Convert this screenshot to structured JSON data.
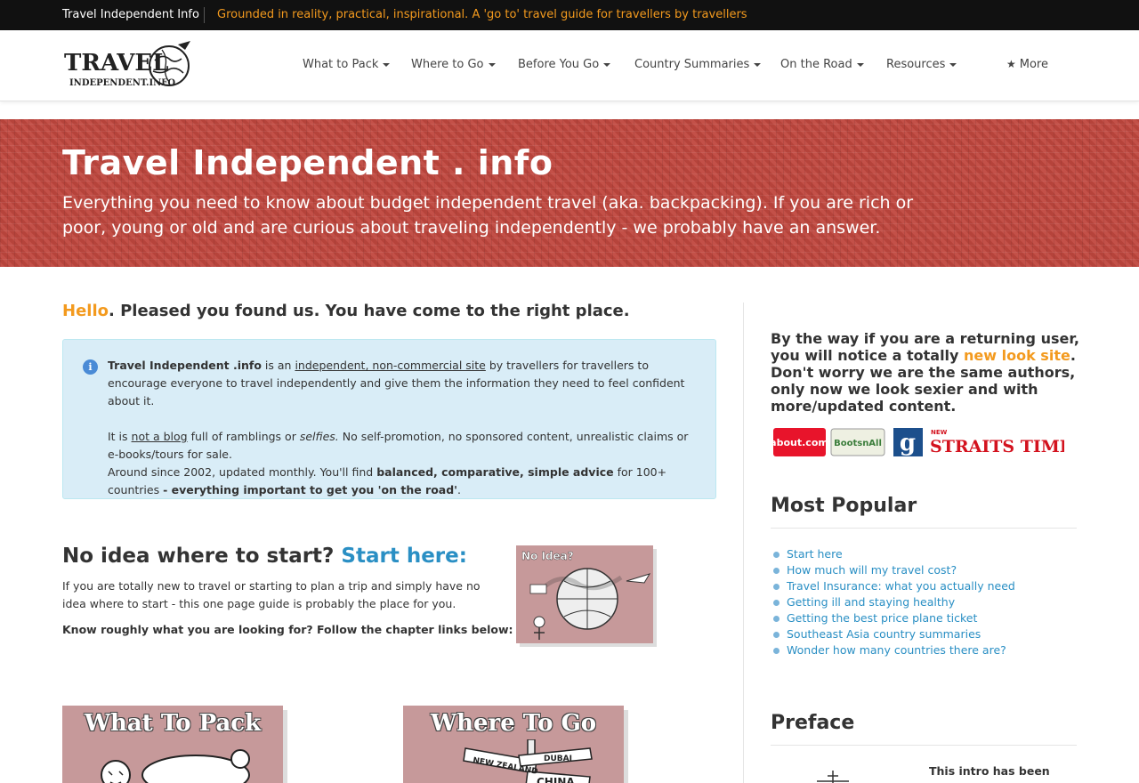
{
  "topbar": {
    "site_name": "Travel Independent Info",
    "tagline": "Grounded in reality, practical, inspirational. A 'go to' travel guide for travellers by travellers"
  },
  "logo": {
    "line1": "TRAVEL",
    "line2": "INDEPENDENT.INFO"
  },
  "nav": {
    "items": [
      {
        "label": "What to Pack"
      },
      {
        "label": "Where to Go"
      },
      {
        "label": "Before You Go"
      },
      {
        "label": "Country Summaries"
      },
      {
        "label": "On the Road"
      },
      {
        "label": "Resources"
      }
    ],
    "more_label": "More",
    "more_icon": "star-icon"
  },
  "hero": {
    "title": "Travel Independent . info",
    "subtitle": "Everything you need to know about budget independent travel (aka. backpacking). If you are rich or poor, young or old and are curious about traveling independently - we probably have an answer.",
    "bg_color": "#c0473e"
  },
  "main": {
    "hello_word": "Hello",
    "hello_rest": ". Pleased you found us. You have come to the right place.",
    "info": {
      "brand": "Travel Independent .info",
      "is_an": " is an ",
      "link1": "independent, non-commercial site",
      "p1_rest": " by travellers for travellers to encourage everyone to travel independently and give them the information they need to feel confident about it.",
      "it_is": "It is ",
      "link2": "not a blog",
      "full_of": " full of ramblings or ",
      "selfies": "selfies.",
      "p2_rest": " No self-promotion, no sponsored content, unrealistic claims or e-books/tours for sale.",
      "p3_start": "Around since 2002, updated monthly. You'll find ",
      "p3_bold": "balanced, comparative, simple advice",
      "p3_mid": " for 100+ countries ",
      "p3_bold2": "- everything important to get you 'on the road'",
      "p3_end": "."
    },
    "noidea": {
      "heading": "No idea where to start? ",
      "heading_link": "Start here:",
      "text": "If you are totally new to travel or starting to plan a trip and simply have no idea where to start - this one page guide is probably the place for you.",
      "bold": "Know roughly what you are looking for? Follow the chapter links below:",
      "image_text": "No Idea?"
    },
    "chapters": [
      {
        "title": "What To Pack"
      },
      {
        "title": "Where To Go"
      }
    ]
  },
  "sidebar": {
    "returning_start": "By the way if you are a returning user, you will notice a totally ",
    "returning_link": "new look site",
    "returning_end": ". Don't worry we are the same authors, only now we look sexier and with more/updated content.",
    "press": [
      "about.com",
      "BootsnAll",
      "g",
      "New Straits Times"
    ],
    "popular_title": "Most Popular",
    "popular": [
      "Start here",
      "How much will my travel cost?",
      "Travel Insurance: what you actually need",
      "Getting ill and staying healthy",
      "Getting the best price plane ticket",
      "Southeast Asia country summaries",
      "Wonder how many countries there are?"
    ],
    "preface_title": "Preface",
    "preface_text": "This intro has been"
  },
  "colors": {
    "accent_orange": "#f39a1e",
    "link_blue": "#2a8fc4",
    "info_bg": "#d9edf7"
  }
}
